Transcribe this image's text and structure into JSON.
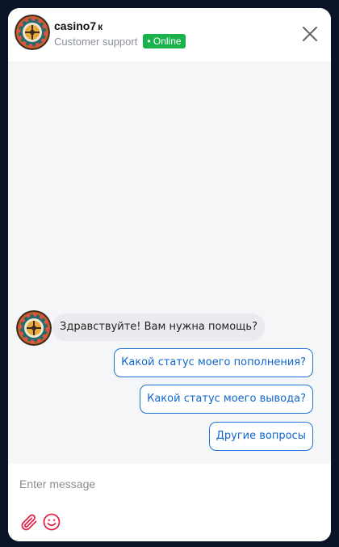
{
  "header": {
    "brand_name": "casino7",
    "brand_suffix": "к",
    "subtitle": "Customer support",
    "status": "• Online",
    "close_icon": "close-icon",
    "avatar_icon": "roulette-wheel-icon"
  },
  "messages": [
    {
      "from": "bot",
      "text": "Здравствуйте! Вам нужна помощь?"
    }
  ],
  "quick_replies": [
    "Какой статус моего пополнения?",
    "Какой статус моего вывода?",
    "Другие вопросы"
  ],
  "composer": {
    "placeholder": "Enter message",
    "value": "",
    "attach_icon": "paperclip-icon",
    "emoji_icon": "smiley-icon"
  },
  "colors": {
    "page_bg": "#0b1426",
    "chat_bg": "#f4f6f7",
    "online": "#19b24b",
    "accent": "#1b74d6",
    "icon_red": "#e0244a"
  }
}
